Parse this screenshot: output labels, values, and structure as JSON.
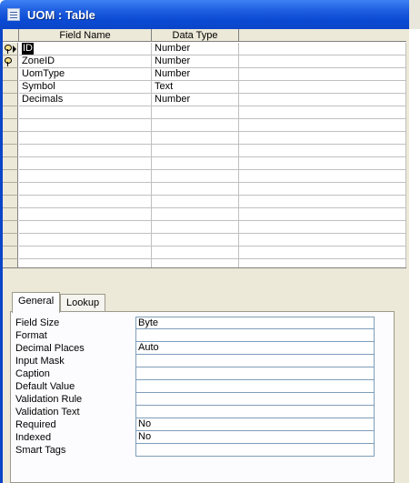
{
  "window": {
    "title": "UOM : Table",
    "icon": "table-icon"
  },
  "grid": {
    "columns": [
      "Field Name",
      "Data Type",
      ""
    ],
    "rows": [
      {
        "field": "ID",
        "type": "Number",
        "primary_key": true,
        "current": true
      },
      {
        "field": "ZoneID",
        "type": "Number",
        "primary_key": true,
        "current": false
      },
      {
        "field": "UomType",
        "type": "Number",
        "primary_key": false,
        "current": false
      },
      {
        "field": "Symbol",
        "type": "Text",
        "primary_key": false,
        "current": false
      },
      {
        "field": "Decimals",
        "type": "Number",
        "primary_key": false,
        "current": false
      }
    ],
    "empty_rows": 13
  },
  "properties": {
    "tabs": [
      "General",
      "Lookup"
    ],
    "active_tab": "General",
    "items": [
      {
        "label": "Field Size",
        "value": "Byte"
      },
      {
        "label": "Format",
        "value": ""
      },
      {
        "label": "Decimal Places",
        "value": "Auto"
      },
      {
        "label": "Input Mask",
        "value": ""
      },
      {
        "label": "Caption",
        "value": ""
      },
      {
        "label": "Default Value",
        "value": ""
      },
      {
        "label": "Validation Rule",
        "value": ""
      },
      {
        "label": "Validation Text",
        "value": ""
      },
      {
        "label": "Required",
        "value": "No"
      },
      {
        "label": "Indexed",
        "value": "No"
      },
      {
        "label": "Smart Tags",
        "value": ""
      }
    ]
  }
}
